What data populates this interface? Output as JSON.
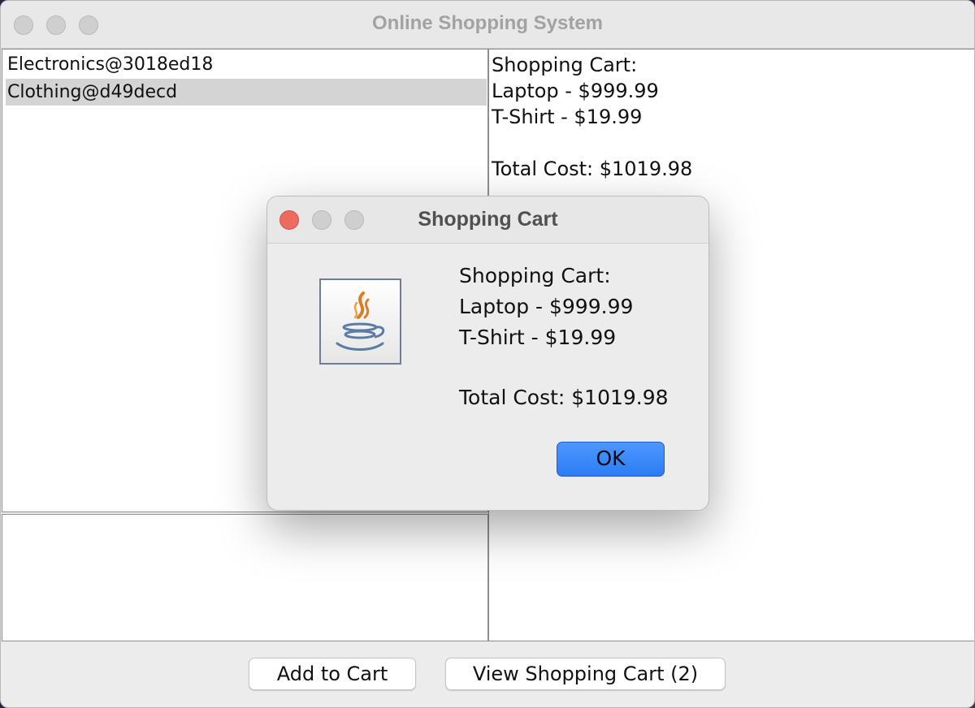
{
  "window": {
    "title": "Online Shopping System"
  },
  "category_list": {
    "items": [
      {
        "label": "Electronics@3018ed18",
        "selected": false
      },
      {
        "label": "Clothing@d49decd",
        "selected": true
      }
    ]
  },
  "cart_panel": {
    "heading": "Shopping Cart:",
    "lines": [
      "Laptop - $999.99",
      "T-Shirt - $19.99"
    ],
    "total": "Total Cost: $1019.98"
  },
  "buttons": {
    "add_to_cart": "Add to Cart",
    "view_cart": "View Shopping Cart (2)"
  },
  "dialog": {
    "title": "Shopping Cart",
    "heading": "Shopping Cart:",
    "lines": [
      "Laptop - $999.99",
      "T-Shirt - $19.99"
    ],
    "total": "Total Cost: $1019.98",
    "ok_label": "OK",
    "icon": "java-cup-icon"
  },
  "colors": {
    "close_button": "#ed6a5e",
    "ok_button": "#3b86f8",
    "selection": "#d4d4d4"
  }
}
